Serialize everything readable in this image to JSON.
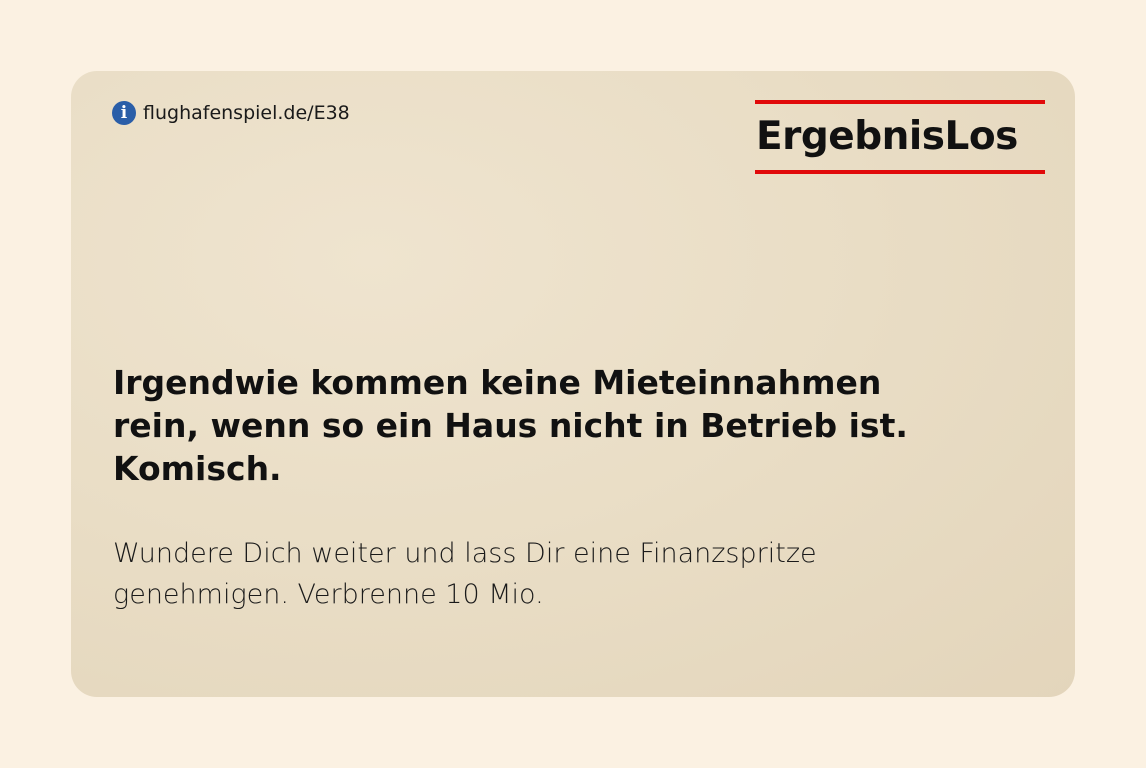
{
  "card": {
    "link": "flughafenspiel.de/E38",
    "info_icon": "info-circle-icon",
    "brand_title": "ErgebnisLos",
    "accent_color": "#e10a0a",
    "headline": "Irgendwie kommen keine Mieteinnahmen rein, wenn so ein Haus nicht in Betrieb ist. Komisch.",
    "body": "Wundere Dich weiter und lass Dir eine Finanzspritze genehmigen. Verbrenne 10 Mio."
  }
}
